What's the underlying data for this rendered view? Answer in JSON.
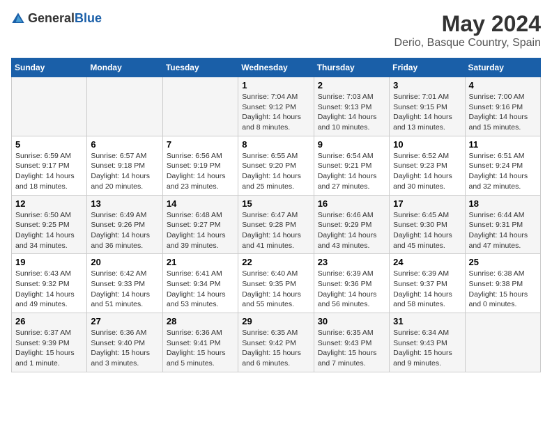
{
  "header": {
    "logo_general": "General",
    "logo_blue": "Blue",
    "title": "May 2024",
    "subtitle": "Derio, Basque Country, Spain"
  },
  "days_of_week": [
    "Sunday",
    "Monday",
    "Tuesday",
    "Wednesday",
    "Thursday",
    "Friday",
    "Saturday"
  ],
  "weeks": [
    [
      {
        "day": "",
        "info": ""
      },
      {
        "day": "",
        "info": ""
      },
      {
        "day": "",
        "info": ""
      },
      {
        "day": "1",
        "info": "Sunrise: 7:04 AM\nSunset: 9:12 PM\nDaylight: 14 hours\nand 8 minutes."
      },
      {
        "day": "2",
        "info": "Sunrise: 7:03 AM\nSunset: 9:13 PM\nDaylight: 14 hours\nand 10 minutes."
      },
      {
        "day": "3",
        "info": "Sunrise: 7:01 AM\nSunset: 9:15 PM\nDaylight: 14 hours\nand 13 minutes."
      },
      {
        "day": "4",
        "info": "Sunrise: 7:00 AM\nSunset: 9:16 PM\nDaylight: 14 hours\nand 15 minutes."
      }
    ],
    [
      {
        "day": "5",
        "info": "Sunrise: 6:59 AM\nSunset: 9:17 PM\nDaylight: 14 hours\nand 18 minutes."
      },
      {
        "day": "6",
        "info": "Sunrise: 6:57 AM\nSunset: 9:18 PM\nDaylight: 14 hours\nand 20 minutes."
      },
      {
        "day": "7",
        "info": "Sunrise: 6:56 AM\nSunset: 9:19 PM\nDaylight: 14 hours\nand 23 minutes."
      },
      {
        "day": "8",
        "info": "Sunrise: 6:55 AM\nSunset: 9:20 PM\nDaylight: 14 hours\nand 25 minutes."
      },
      {
        "day": "9",
        "info": "Sunrise: 6:54 AM\nSunset: 9:21 PM\nDaylight: 14 hours\nand 27 minutes."
      },
      {
        "day": "10",
        "info": "Sunrise: 6:52 AM\nSunset: 9:23 PM\nDaylight: 14 hours\nand 30 minutes."
      },
      {
        "day": "11",
        "info": "Sunrise: 6:51 AM\nSunset: 9:24 PM\nDaylight: 14 hours\nand 32 minutes."
      }
    ],
    [
      {
        "day": "12",
        "info": "Sunrise: 6:50 AM\nSunset: 9:25 PM\nDaylight: 14 hours\nand 34 minutes."
      },
      {
        "day": "13",
        "info": "Sunrise: 6:49 AM\nSunset: 9:26 PM\nDaylight: 14 hours\nand 36 minutes."
      },
      {
        "day": "14",
        "info": "Sunrise: 6:48 AM\nSunset: 9:27 PM\nDaylight: 14 hours\nand 39 minutes."
      },
      {
        "day": "15",
        "info": "Sunrise: 6:47 AM\nSunset: 9:28 PM\nDaylight: 14 hours\nand 41 minutes."
      },
      {
        "day": "16",
        "info": "Sunrise: 6:46 AM\nSunset: 9:29 PM\nDaylight: 14 hours\nand 43 minutes."
      },
      {
        "day": "17",
        "info": "Sunrise: 6:45 AM\nSunset: 9:30 PM\nDaylight: 14 hours\nand 45 minutes."
      },
      {
        "day": "18",
        "info": "Sunrise: 6:44 AM\nSunset: 9:31 PM\nDaylight: 14 hours\nand 47 minutes."
      }
    ],
    [
      {
        "day": "19",
        "info": "Sunrise: 6:43 AM\nSunset: 9:32 PM\nDaylight: 14 hours\nand 49 minutes."
      },
      {
        "day": "20",
        "info": "Sunrise: 6:42 AM\nSunset: 9:33 PM\nDaylight: 14 hours\nand 51 minutes."
      },
      {
        "day": "21",
        "info": "Sunrise: 6:41 AM\nSunset: 9:34 PM\nDaylight: 14 hours\nand 53 minutes."
      },
      {
        "day": "22",
        "info": "Sunrise: 6:40 AM\nSunset: 9:35 PM\nDaylight: 14 hours\nand 55 minutes."
      },
      {
        "day": "23",
        "info": "Sunrise: 6:39 AM\nSunset: 9:36 PM\nDaylight: 14 hours\nand 56 minutes."
      },
      {
        "day": "24",
        "info": "Sunrise: 6:39 AM\nSunset: 9:37 PM\nDaylight: 14 hours\nand 58 minutes."
      },
      {
        "day": "25",
        "info": "Sunrise: 6:38 AM\nSunset: 9:38 PM\nDaylight: 15 hours\nand 0 minutes."
      }
    ],
    [
      {
        "day": "26",
        "info": "Sunrise: 6:37 AM\nSunset: 9:39 PM\nDaylight: 15 hours\nand 1 minute."
      },
      {
        "day": "27",
        "info": "Sunrise: 6:36 AM\nSunset: 9:40 PM\nDaylight: 15 hours\nand 3 minutes."
      },
      {
        "day": "28",
        "info": "Sunrise: 6:36 AM\nSunset: 9:41 PM\nDaylight: 15 hours\nand 5 minutes."
      },
      {
        "day": "29",
        "info": "Sunrise: 6:35 AM\nSunset: 9:42 PM\nDaylight: 15 hours\nand 6 minutes."
      },
      {
        "day": "30",
        "info": "Sunrise: 6:35 AM\nSunset: 9:43 PM\nDaylight: 15 hours\nand 7 minutes."
      },
      {
        "day": "31",
        "info": "Sunrise: 6:34 AM\nSunset: 9:43 PM\nDaylight: 15 hours\nand 9 minutes."
      },
      {
        "day": "",
        "info": ""
      }
    ]
  ]
}
